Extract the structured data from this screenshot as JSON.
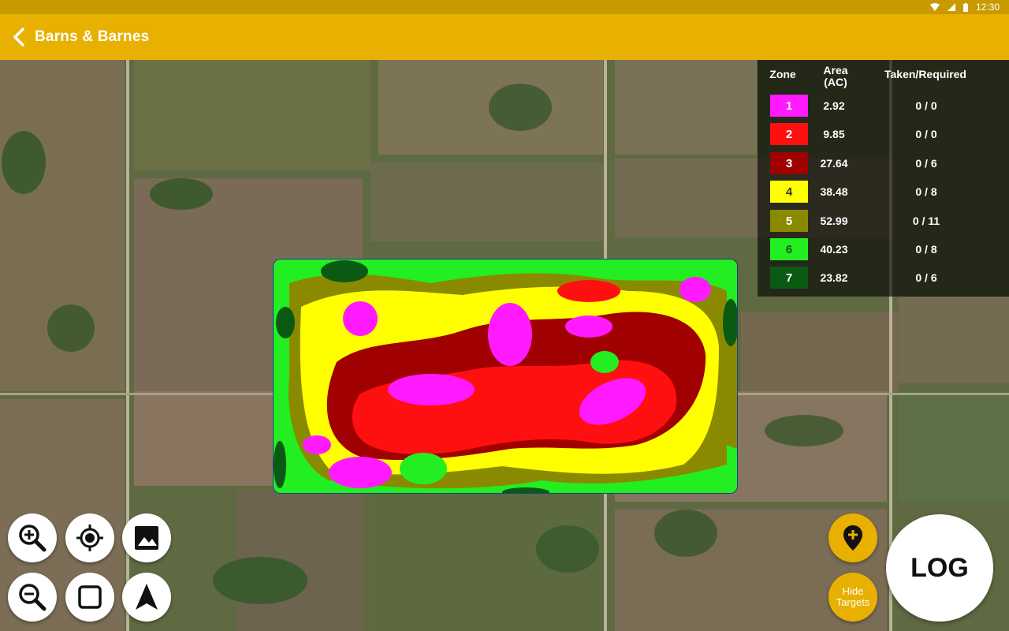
{
  "status_bar": {
    "time": "12:30",
    "icons": [
      "wifi-icon",
      "signal-icon",
      "battery-icon"
    ]
  },
  "app_bar": {
    "title": "Barns & Barnes",
    "back_icon": "back-chevron-icon"
  },
  "legend": {
    "headers": {
      "zone": "Zone",
      "area": "Area\n(AC)",
      "taken": "Taken/Required"
    },
    "rows": [
      {
        "zone": "1",
        "area": "2.92",
        "taken": "0 / 0",
        "color": "#ff1aff"
      },
      {
        "zone": "2",
        "area": "9.85",
        "taken": "0 / 0",
        "color": "#ff1010"
      },
      {
        "zone": "3",
        "area": "27.64",
        "taken": "0 / 6",
        "color": "#a00000"
      },
      {
        "zone": "4",
        "area": "38.48",
        "taken": "0 / 8",
        "color": "#ffff00"
      },
      {
        "zone": "5",
        "area": "52.99",
        "taken": "0 / 11",
        "color": "#8a8a00"
      },
      {
        "zone": "6",
        "area": "40.23",
        "taken": "0 / 8",
        "color": "#22ee22"
      },
      {
        "zone": "7",
        "area": "23.82",
        "taken": "0 / 6",
        "color": "#0a5a14"
      }
    ]
  },
  "controls": {
    "zoom_in": "zoom-in-icon",
    "locate": "my-location-icon",
    "layers": "image-icon",
    "zoom_out": "zoom-out-icon",
    "select": "square-icon",
    "navigate": "navigation-arrow-icon",
    "add_pin": "add-location-icon",
    "hide_targets": "Hide\nTargets",
    "log": "LOG"
  }
}
